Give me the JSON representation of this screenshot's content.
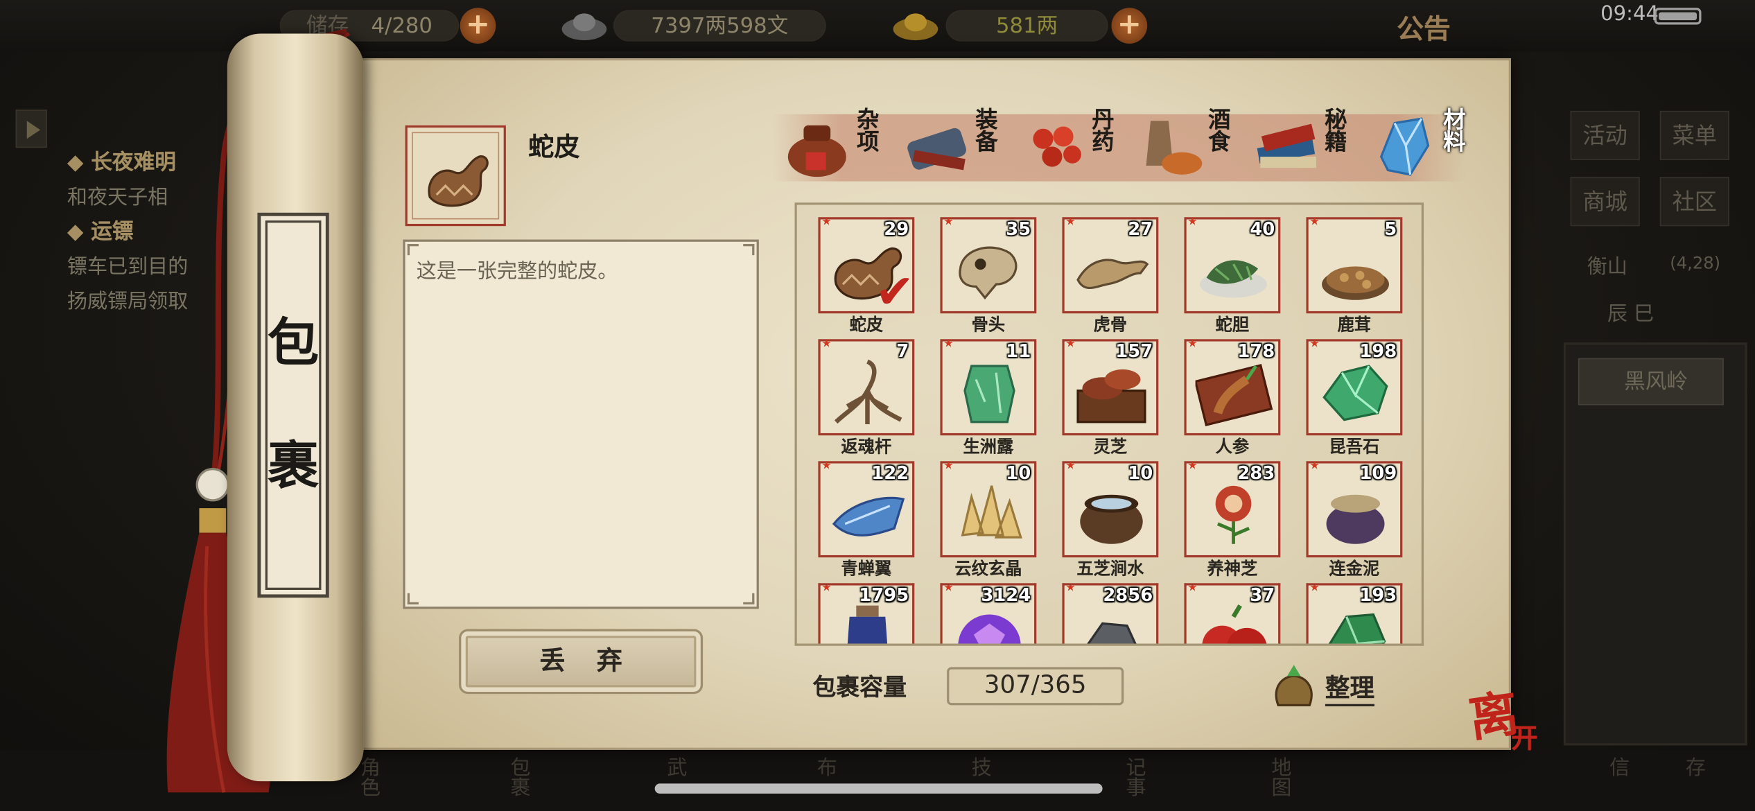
{
  "topbar": {
    "storage_label": "储存",
    "storage_value": "4/280",
    "money": "7397两598文",
    "gold": "581两",
    "notice": "公告",
    "time": "09:44"
  },
  "quests": [
    {
      "title": "长夜难明",
      "desc": "和夜天子相"
    },
    {
      "title": "运镖",
      "desc1": "镖车已到目的",
      "desc2": "扬威镖局领取"
    }
  ],
  "right_menu": {
    "buttons": [
      "活动",
      "菜单",
      "商城",
      "社区"
    ],
    "location": "衡山",
    "coords": "(4,28)",
    "time_label": "辰 巳",
    "place": "黑风岭"
  },
  "bottom_nav": [
    "角色",
    "包裹",
    "武",
    "布",
    "技",
    "记事",
    "地图",
    "信",
    "存"
  ],
  "panel": {
    "title_chars": [
      "包",
      "裹"
    ],
    "selected_item_name": "蛇皮",
    "description": "这是一张完整的蛇皮。",
    "drop_button": "丢弃",
    "capacity_label": "包裹容量",
    "capacity_value": "307/365",
    "sort_button": "整理",
    "leave_button": "离开"
  },
  "tabs": [
    {
      "label": "杂项",
      "icon": "jar-icon",
      "active": false
    },
    {
      "label": "装备",
      "icon": "equipment-icon",
      "active": false
    },
    {
      "label": "丹药",
      "icon": "pills-icon",
      "active": false
    },
    {
      "label": "酒食",
      "icon": "food-icon",
      "active": false
    },
    {
      "label": "秘籍",
      "icon": "book-icon",
      "active": false
    },
    {
      "label": "材料",
      "icon": "crystal-icon",
      "active": true
    }
  ],
  "items": [
    {
      "name": "蛇皮",
      "count": "29",
      "icon": "snakeskin-icon",
      "selected": true,
      "color": "#8a5a34"
    },
    {
      "name": "骨头",
      "count": "35",
      "icon": "bone-icon",
      "color": "#c8b48e"
    },
    {
      "name": "虎骨",
      "count": "27",
      "icon": "tiger-bone-icon",
      "color": "#b99a6a"
    },
    {
      "name": "蛇胆",
      "count": "40",
      "icon": "snake-gall-icon",
      "color": "#3f6b3a"
    },
    {
      "name": "鹿茸",
      "count": "5",
      "icon": "antler-icon",
      "color": "#9b6b3c"
    },
    {
      "name": "返魂杆",
      "count": "7",
      "icon": "root-icon",
      "color": "#6e5238"
    },
    {
      "name": "生洲露",
      "count": "11",
      "icon": "green-jar-icon",
      "color": "#4aa873"
    },
    {
      "name": "灵芝",
      "count": "157",
      "icon": "lingzhi-icon",
      "color": "#8a3b22"
    },
    {
      "name": "人参",
      "count": "178",
      "icon": "ginseng-icon",
      "color": "#b86f36"
    },
    {
      "name": "昆吾石",
      "count": "198",
      "icon": "green-stone-icon",
      "color": "#3fa86c"
    },
    {
      "name": "青蝉翼",
      "count": "122",
      "icon": "blue-wing-icon",
      "color": "#4f86c8"
    },
    {
      "name": "云纹玄晶",
      "count": "10",
      "icon": "crystal-cluster-icon",
      "color": "#e3c27a"
    },
    {
      "name": "五芝涧水",
      "count": "10",
      "icon": "water-pot-icon",
      "color": "#5a3b24"
    },
    {
      "name": "养神芝",
      "count": "283",
      "icon": "flower-icon",
      "color": "#c0402a"
    },
    {
      "name": "连金泥",
      "count": "109",
      "icon": "mud-pot-icon",
      "color": "#4d3a5e"
    },
    {
      "name": "",
      "count": "1795",
      "icon": "blue-bottle-icon",
      "color": "#2e3d8a"
    },
    {
      "name": "",
      "count": "3124",
      "icon": "purple-gem-icon",
      "color": "#7b3bd0"
    },
    {
      "name": "",
      "count": "2856",
      "icon": "gray-stone-icon",
      "color": "#5b5e62"
    },
    {
      "name": "",
      "count": "37",
      "icon": "apple-icon",
      "color": "#c72a22"
    },
    {
      "name": "",
      "count": "193",
      "icon": "jade-icon",
      "color": "#2f8a4e"
    }
  ]
}
